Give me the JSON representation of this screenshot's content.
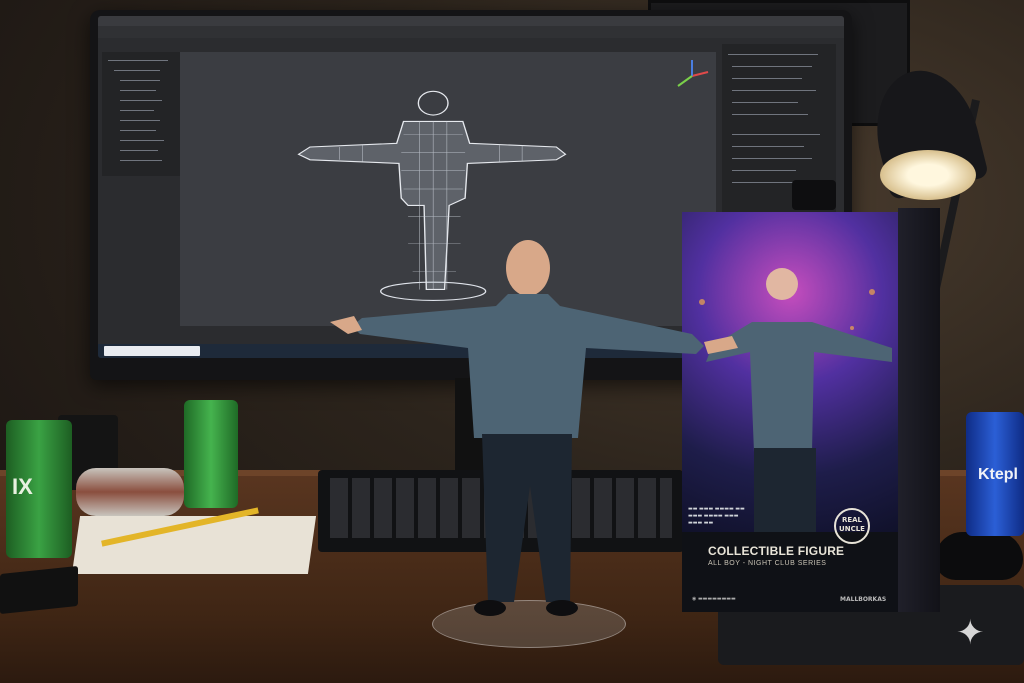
{
  "scene": {
    "description_labels": {
      "box_title": "COLLECTIBLE FIGURE",
      "box_subtitle": "ALL BOY - NIGHT CLUB SERIES",
      "box_badge": "REAL UNCLE",
      "box_bottom_right": "MALLBORKAS",
      "can_left_text": "IX",
      "can_right_text": "Ktepl"
    }
  },
  "colors": {
    "sweater": "#4d6474",
    "pants": "#1d2631",
    "desk": "#4a2c18",
    "screen_bg": "#2b2c2f"
  }
}
